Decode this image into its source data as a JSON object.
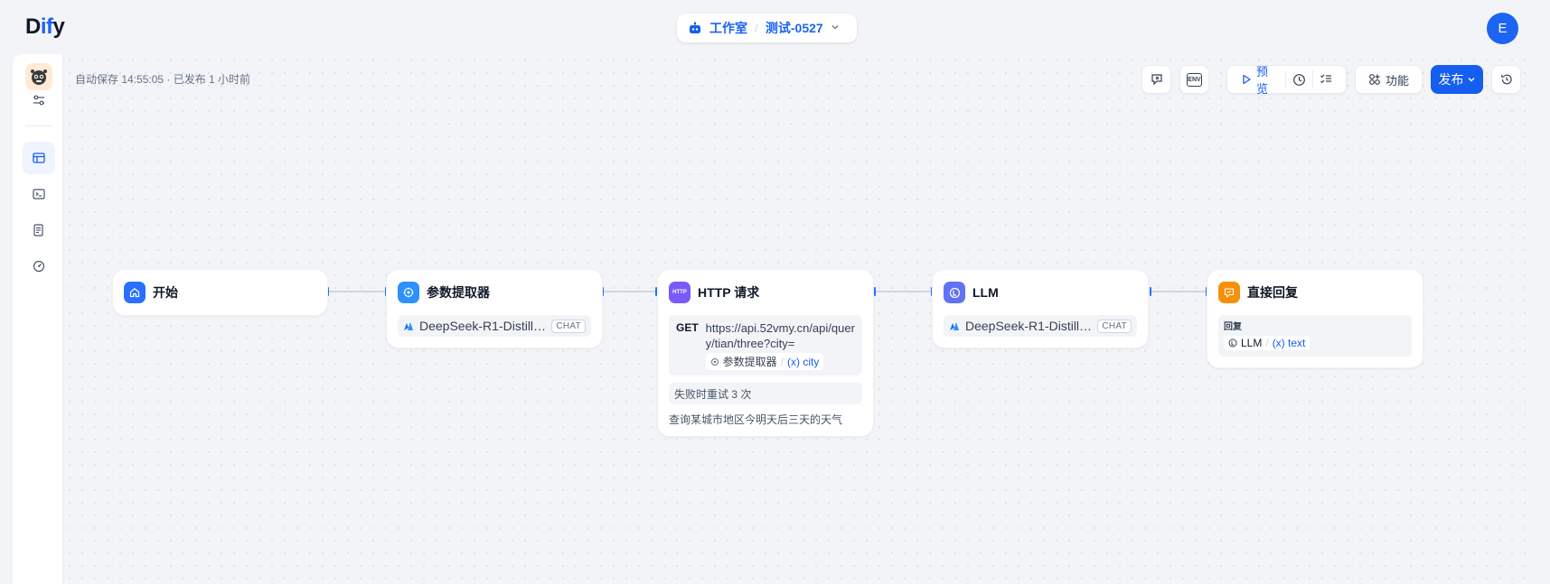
{
  "app": {
    "logo_prefix": "D",
    "logo_accent": "if",
    "logo_suffix": "y",
    "breadcrumb_studio": "工作室",
    "breadcrumb_sep": "/",
    "app_name": "测试-0527",
    "user_initial": "E"
  },
  "canvas": {
    "autosave_text": "自动保存 14:55:05 · 已发布 1 小时前"
  },
  "toolbar": {
    "env_label": "ENV",
    "preview_label": "预览",
    "features_label": "功能",
    "publish_label": "发布"
  },
  "nodes": {
    "start": {
      "title": "开始"
    },
    "extractor": {
      "title": "参数提取器",
      "model": "DeepSeek-R1-Distill-...",
      "model_badge": "CHAT"
    },
    "http": {
      "title": "HTTP 请求",
      "icon_text": "HTTP",
      "method": "GET",
      "url": "https://api.52vmy.cn/api/query/tian/three?city=",
      "var_node": "参数提取器",
      "var_name": "(x) city",
      "retry_text": "失败时重试 3 次",
      "description": "查询某城市地区今明天后三天的天气"
    },
    "llm": {
      "title": "LLM",
      "model": "DeepSeek-R1-Distill-...",
      "model_badge": "CHAT"
    },
    "reply": {
      "title": "直接回复",
      "label": "回复",
      "var_node": "LLM",
      "var_name": "(x) text"
    }
  },
  "colors": {
    "primary": "#155eef",
    "start_icon": "#2970ff",
    "extractor_icon": "#2e90fa",
    "http_icon": "#7a5af8",
    "llm_icon": "#6172f3",
    "reply_icon": "#f79009"
  }
}
